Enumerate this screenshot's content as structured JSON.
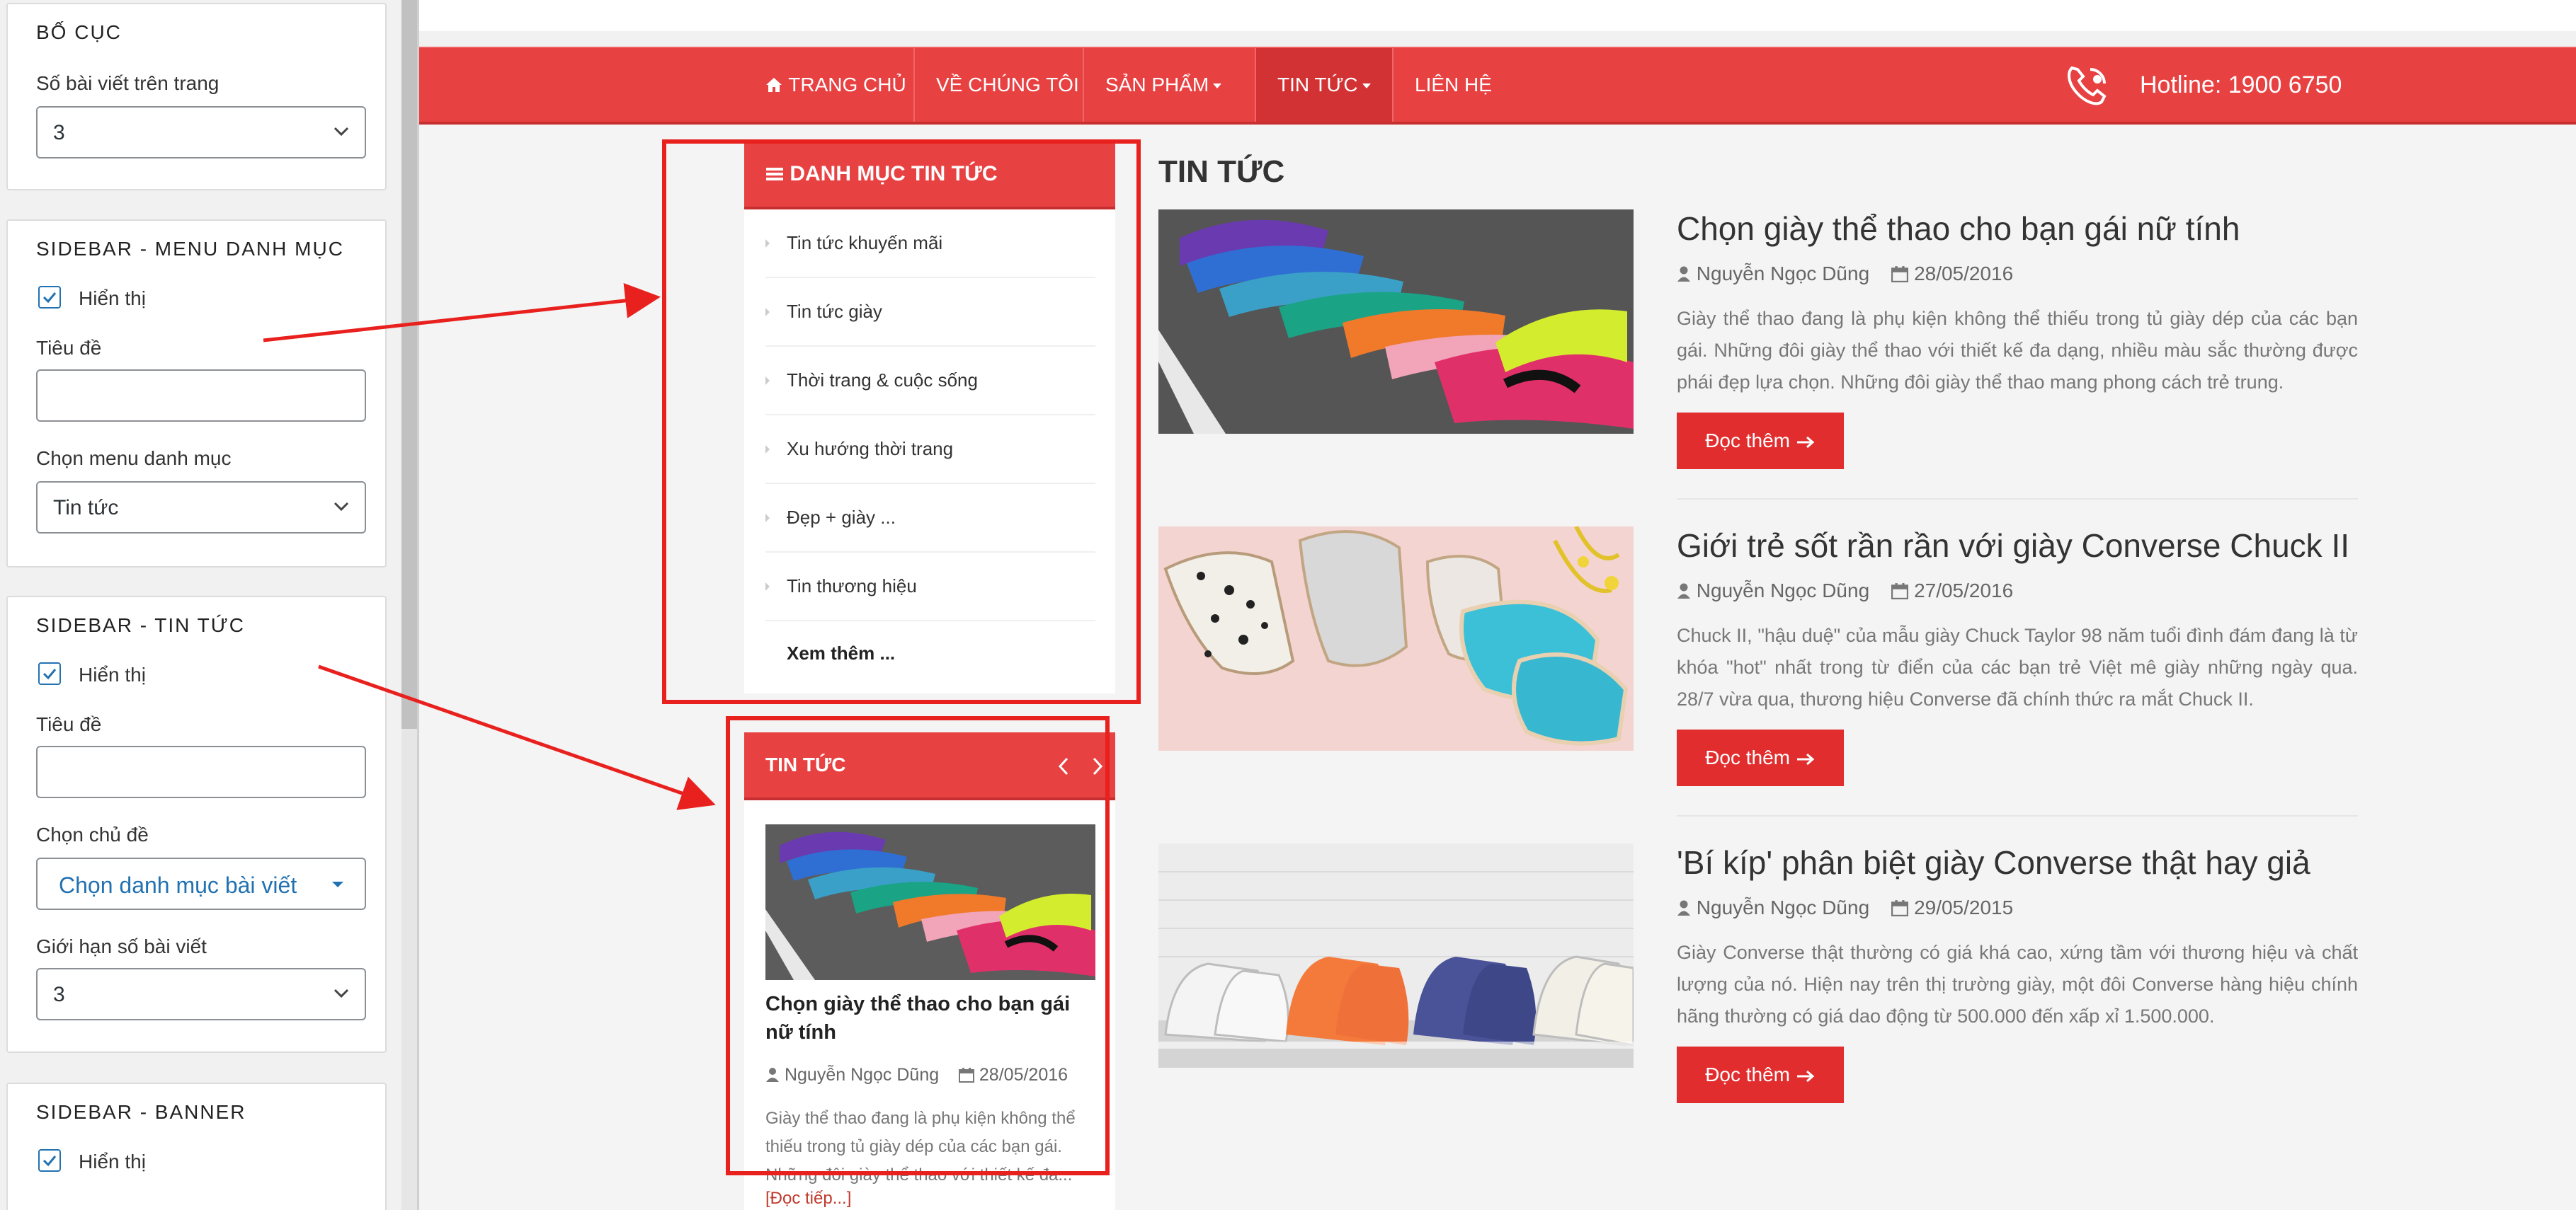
{
  "settings": {
    "layout": {
      "title": "BỐ CỤC",
      "posts_per_page_label": "Số bài viết trên trang",
      "posts_per_page_value": "3"
    },
    "menu": {
      "title": "SIDEBAR - MENU DANH MỤC",
      "show_label": "Hiển thị",
      "title_label": "Tiêu đề",
      "title_value": "",
      "choose_menu_label": "Chọn menu danh mục",
      "choose_menu_value": "Tin tức"
    },
    "news": {
      "title": "SIDEBAR - TIN TỨC",
      "show_label": "Hiển thị",
      "title_label": "Tiêu đề",
      "title_value": "",
      "topic_label": "Chọn chủ đề",
      "topic_value": "Chọn danh mục bài viết",
      "limit_label": "Giới hạn số bài viết",
      "limit_value": "3"
    },
    "banner": {
      "title": "SIDEBAR - BANNER",
      "show_label": "Hiển thị"
    }
  },
  "nav": {
    "items": [
      {
        "label": "TRANG CHỦ",
        "icon": "home-icon"
      },
      {
        "label": "VỀ CHÚNG TÔI"
      },
      {
        "label": "SẢN PHẨM",
        "dropdown": true
      },
      {
        "label": "TIN TỨC",
        "dropdown": true,
        "active": true
      },
      {
        "label": "LIÊN HỆ"
      }
    ],
    "hotline": "Hotline: 1900 6750"
  },
  "category_widget": {
    "title": "DANH MỤC TIN TỨC",
    "items": [
      "Tin tức khuyến mãi",
      "Tin tức giày",
      "Thời trang & cuộc sống",
      "Xu hướng thời trang",
      "Đẹp + giày ...",
      "Tin thương hiệu"
    ],
    "more": "Xem thêm ..."
  },
  "news_widget": {
    "title": "TIN TỨC",
    "post": {
      "title": "Chọn giày thể thao cho bạn gái nữ tính",
      "author": "Nguyễn Ngọc Dũng",
      "date": "28/05/2016",
      "excerpt": "Giày thể thao đang là phụ kiện không thể thiếu trong tủ giày dép của các bạn gái. Những đôi giày thể thao với thiết kế đa...",
      "read_more": "[Đọc tiếp...]"
    }
  },
  "main": {
    "heading": "TIN TỨC",
    "read_more_label": "Đọc thêm",
    "posts": [
      {
        "title": "Chọn giày thể thao cho bạn gái nữ tính",
        "author": "Nguyễn Ngọc Dũng",
        "date": "28/05/2016",
        "excerpt": "Giày thể thao đang là phụ kiện không thể thiếu trong tủ giày dép của các bạn gái. Những đôi giày thể thao với thiết kế đa dạng, nhiều màu sắc thường được phái đẹp lựa chọn. Những đôi giày thể thao mang phong cách trẻ trung."
      },
      {
        "title": "Giới trẻ sốt rần rần với giày Converse Chuck II",
        "author": "Nguyễn Ngọc Dũng",
        "date": "27/05/2016",
        "excerpt": "Chuck II, \"hậu duệ\" của mẫu giày Chuck Taylor 98 năm tuổi đình đám đang là từ khóa \"hot\" nhất trong từ điển của các bạn trẻ Việt mê giày những ngày qua. 28/7 vừa qua, thương hiệu Converse đã chính thức ra mắt Chuck II."
      },
      {
        "title": "'Bí kíp' phân biệt giày Converse thật hay giả",
        "author": "Nguyễn Ngọc Dũng",
        "date": "29/05/2015",
        "excerpt": "Giày Converse thật thường có giá khá cao, xứng tầm với thương hiệu và chất lượng của nó. Hiện nay trên thị trường giày, một đôi Converse hàng hiệu chính hãng thường có giá dao động từ 500.000 đến xấp xỉ 1.500.000."
      }
    ]
  },
  "colors": {
    "brand_red": "#e84142",
    "annotation_red": "#e8211e",
    "wp_blue": "#2271b1"
  }
}
